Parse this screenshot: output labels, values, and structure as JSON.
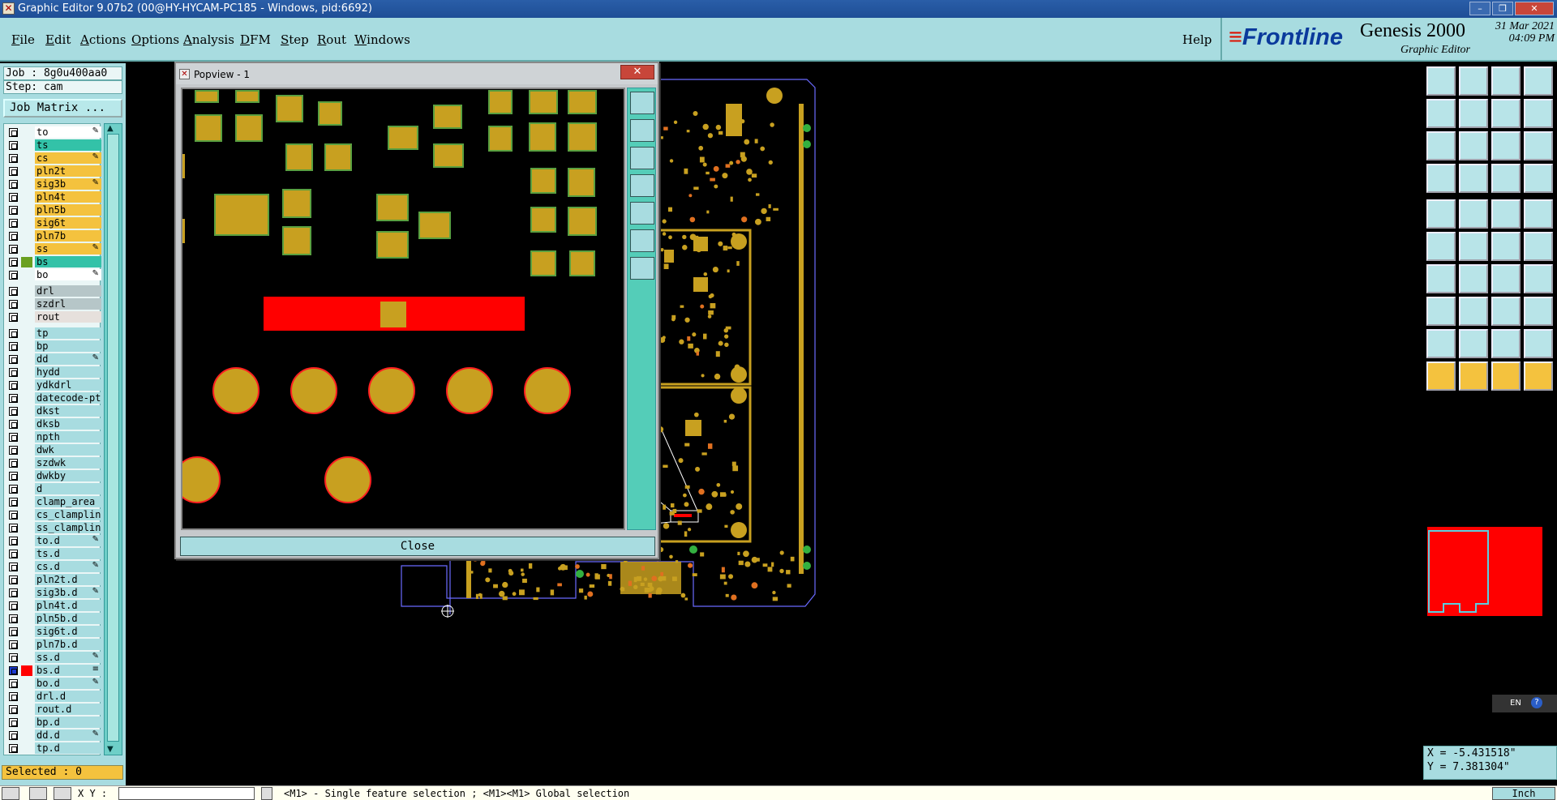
{
  "window": {
    "title": "Graphic Editor 9.07b2 (00@HY-HYCAM-PC185 - Windows, pid:6692)"
  },
  "menu": {
    "items": [
      {
        "label": "File",
        "ul": "F",
        "rest": "ile"
      },
      {
        "label": "Edit",
        "ul": "E",
        "rest": "dit"
      },
      {
        "label": "Actions",
        "ul": "A",
        "rest": "ctions"
      },
      {
        "label": "Options",
        "ul": "O",
        "rest": "ptions"
      },
      {
        "label": "Analysis",
        "ul": "A",
        "rest": "nalysis"
      },
      {
        "label": "DFM",
        "ul": "D",
        "rest": "FM"
      },
      {
        "label": "Step",
        "ul": "S",
        "rest": "tep"
      },
      {
        "label": "Rout",
        "ul": "R",
        "rest": "out"
      },
      {
        "label": "Windows",
        "ul": "W",
        "rest": "indows"
      }
    ],
    "help": "Help"
  },
  "logo": {
    "brand": "Frontline",
    "product": "Genesis 2000",
    "subtitle": "Graphic Editor",
    "date": "31 Mar 2021",
    "time": "04:09 PM"
  },
  "left": {
    "job": "Job : 8g0u400aa0",
    "step": "Step: cam",
    "job_matrix": "Job Matrix ...",
    "selected": "Selected : 0"
  },
  "layers": [
    {
      "name": "to",
      "color": "#ffffff",
      "mark": "✎"
    },
    {
      "name": "ts",
      "color": "#33c2a8",
      "mark": ""
    },
    {
      "name": "cs",
      "color": "#f4c23e",
      "mark": "✎"
    },
    {
      "name": "pln2t",
      "color": "#f4c23e",
      "mark": ""
    },
    {
      "name": "sig3b",
      "color": "#f4c23e",
      "mark": "✎"
    },
    {
      "name": "pln4t",
      "color": "#f4c23e",
      "mark": ""
    },
    {
      "name": "pln5b",
      "color": "#f4c23e",
      "mark": ""
    },
    {
      "name": "sig6t",
      "color": "#f4c23e",
      "mark": ""
    },
    {
      "name": "pln7b",
      "color": "#f4c23e",
      "mark": ""
    },
    {
      "name": "ss",
      "color": "#f4c23e",
      "mark": "✎"
    },
    {
      "name": "bs",
      "color": "#33c2a8",
      "mark": "",
      "swatch": "#6aa020"
    },
    {
      "name": "bo",
      "color": "#ffffff",
      "mark": "✎"
    },
    {
      "name": "drl",
      "color": "#b6c6c8",
      "mark": "",
      "gap": true
    },
    {
      "name": "szdrl",
      "color": "#b6c6c8",
      "mark": ""
    },
    {
      "name": "rout",
      "color": "#e6e0dc",
      "mark": ""
    },
    {
      "name": "tp",
      "color": "#a8dce0",
      "mark": "",
      "gap": true
    },
    {
      "name": "bp",
      "color": "#a8dce0",
      "mark": ""
    },
    {
      "name": "dd",
      "color": "#a8dce0",
      "mark": "✎"
    },
    {
      "name": "hydd",
      "color": "#a8dce0",
      "mark": ""
    },
    {
      "name": "ydkdrl",
      "color": "#a8dce0",
      "mark": ""
    },
    {
      "name": "datecode-pt",
      "color": "#a8dce0",
      "mark": ""
    },
    {
      "name": "dkst",
      "color": "#a8dce0",
      "mark": ""
    },
    {
      "name": "dksb",
      "color": "#a8dce0",
      "mark": ""
    },
    {
      "name": "npth",
      "color": "#a8dce0",
      "mark": ""
    },
    {
      "name": "dwk",
      "color": "#a8dce0",
      "mark": ""
    },
    {
      "name": "szdwk",
      "color": "#a8dce0",
      "mark": ""
    },
    {
      "name": "dwkby",
      "color": "#a8dce0",
      "mark": ""
    },
    {
      "name": "d",
      "color": "#a8dce0",
      "mark": ""
    },
    {
      "name": "clamp_area",
      "color": "#a8dce0",
      "mark": ""
    },
    {
      "name": "cs_clampline",
      "color": "#a8dce0",
      "mark": ""
    },
    {
      "name": "ss_clampline",
      "color": "#a8dce0",
      "mark": ""
    },
    {
      "name": "to.d",
      "color": "#a8dce0",
      "mark": "✎"
    },
    {
      "name": "ts.d",
      "color": "#a8dce0",
      "mark": ""
    },
    {
      "name": "cs.d",
      "color": "#a8dce0",
      "mark": "✎"
    },
    {
      "name": "pln2t.d",
      "color": "#a8dce0",
      "mark": ""
    },
    {
      "name": "sig3b.d",
      "color": "#a8dce0",
      "mark": "✎"
    },
    {
      "name": "pln4t.d",
      "color": "#a8dce0",
      "mark": ""
    },
    {
      "name": "pln5b.d",
      "color": "#a8dce0",
      "mark": ""
    },
    {
      "name": "sig6t.d",
      "color": "#a8dce0",
      "mark": ""
    },
    {
      "name": "pln7b.d",
      "color": "#a8dce0",
      "mark": ""
    },
    {
      "name": "ss.d",
      "color": "#a8dce0",
      "mark": "✎"
    },
    {
      "name": "bs.d",
      "color": "#a8dce0",
      "mark": "≡",
      "swatch": "#ff0000",
      "active": true
    },
    {
      "name": "bo.d",
      "color": "#a8dce0",
      "mark": "✎"
    },
    {
      "name": "drl.d",
      "color": "#a8dce0",
      "mark": ""
    },
    {
      "name": "rout.d",
      "color": "#a8dce0",
      "mark": ""
    },
    {
      "name": "bp.d",
      "color": "#a8dce0",
      "mark": ""
    },
    {
      "name": "dd.d",
      "color": "#a8dce0",
      "mark": "✎"
    },
    {
      "name": "tp.d",
      "color": "#a8dce0",
      "mark": ""
    }
  ],
  "popview": {
    "title": "Popview - 1",
    "close_label": "Close"
  },
  "coords": {
    "x": "X = -5.431518\"",
    "y": "Y = 7.381304\""
  },
  "lang": "EN",
  "status": {
    "xy_label": "X Y :",
    "message": "<M1> - Single feature selection ; <M1><M1> Global selection",
    "unit": "Inch"
  },
  "colors": {
    "copper": "#c8a020",
    "pad_outline": "#5aa040",
    "highlight": "#ff0000",
    "board_outline": "#6a6aff"
  }
}
